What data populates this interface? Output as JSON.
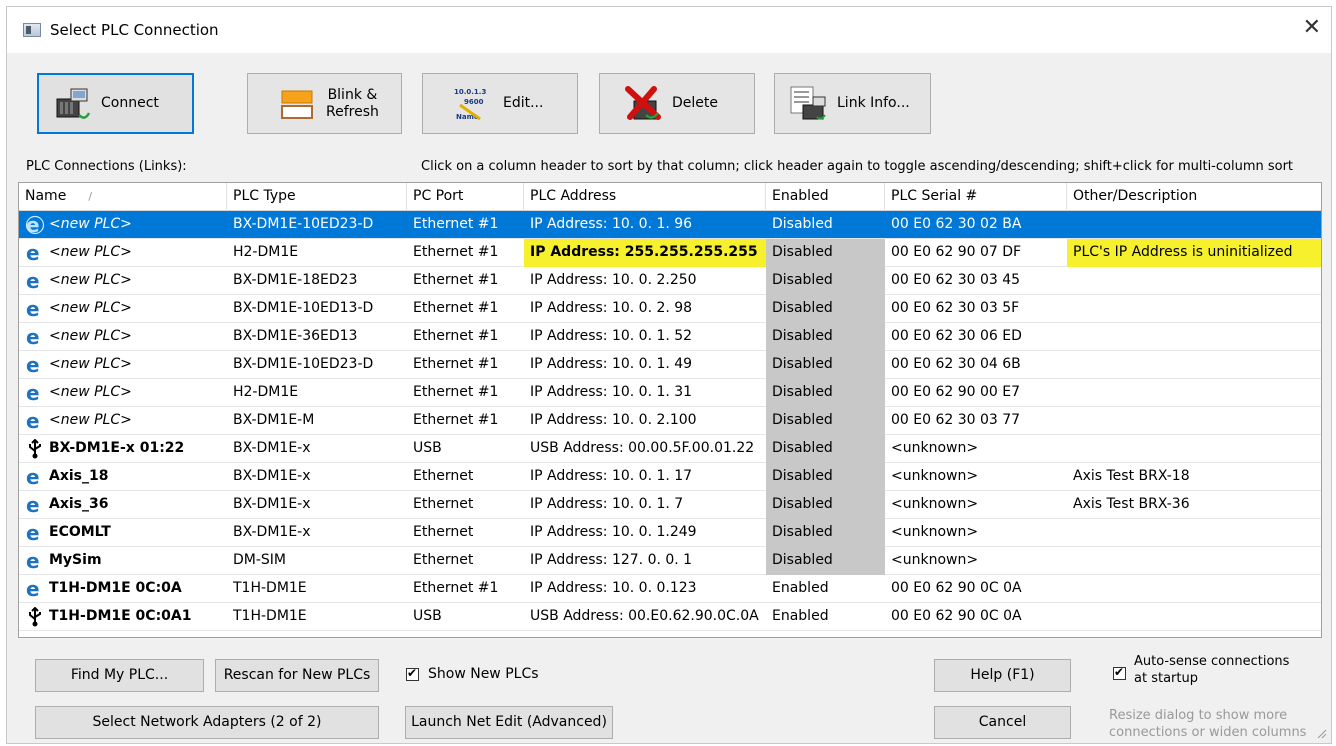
{
  "window": {
    "title": "Select PLC Connection"
  },
  "toolbar": {
    "connect": "Connect",
    "blink_refresh": [
      "Blink &",
      "Refresh"
    ],
    "edit": "Edit...",
    "delete": "Delete",
    "link_info": "Link Info...",
    "edit_icon_text": [
      "10.0.1.3",
      "9600",
      "Name"
    ]
  },
  "labels": {
    "connections": "PLC Connections (Links):",
    "hint": "Click on a column header to sort by that column; click header again to toggle ascending/descending; shift+click for multi-column sort"
  },
  "columns": [
    "Name",
    "PLC Type",
    "PC Port",
    "PLC Address",
    "Enabled",
    "PLC Serial #",
    "Other/Description"
  ],
  "sort_glyph": "/",
  "rows": [
    {
      "icon": "ethernet-selected",
      "name": "<new PLC>",
      "type": "BX-DM1E-10ED23-D",
      "port": "Ethernet #1",
      "address": "IP Address:  10.  0.  1. 96",
      "enabled": "Disabled",
      "serial": "00 E0 62 30 02 BA",
      "desc": "",
      "selected": true,
      "new": true
    },
    {
      "icon": "ethernet",
      "name": "<new PLC>",
      "type": "H2-DM1E",
      "port": "Ethernet #1",
      "address": "IP Address: 255.255.255.255",
      "enabled": "Disabled",
      "serial": "00 E0 62 90 07 DF",
      "desc": "PLC's IP Address is uninitialized",
      "warn": true,
      "new": true
    },
    {
      "icon": "ethernet",
      "name": "<new PLC>",
      "type": "BX-DM1E-18ED23",
      "port": "Ethernet #1",
      "address": "IP Address:  10.  0.  2.250",
      "enabled": "Disabled",
      "serial": "00 E0 62 30 03 45",
      "desc": "",
      "new": true
    },
    {
      "icon": "ethernet",
      "name": "<new PLC>",
      "type": "BX-DM1E-10ED13-D",
      "port": "Ethernet #1",
      "address": "IP Address:  10.  0.  2. 98",
      "enabled": "Disabled",
      "serial": "00 E0 62 30 03 5F",
      "desc": "",
      "new": true
    },
    {
      "icon": "ethernet",
      "name": "<new PLC>",
      "type": "BX-DM1E-36ED13",
      "port": "Ethernet #1",
      "address": "IP Address:  10.  0.  1. 52",
      "enabled": "Disabled",
      "serial": "00 E0 62 30 06 ED",
      "desc": "",
      "new": true
    },
    {
      "icon": "ethernet",
      "name": "<new PLC>",
      "type": "BX-DM1E-10ED23-D",
      "port": "Ethernet #1",
      "address": "IP Address:  10.  0.  1. 49",
      "enabled": "Disabled",
      "serial": "00 E0 62 30 04 6B",
      "desc": "",
      "new": true
    },
    {
      "icon": "ethernet",
      "name": "<new PLC>",
      "type": "H2-DM1E",
      "port": "Ethernet #1",
      "address": "IP Address:  10.  0.  1. 31",
      "enabled": "Disabled",
      "serial": "00 E0 62 90 00 E7",
      "desc": "",
      "new": true
    },
    {
      "icon": "ethernet",
      "name": "<new PLC>",
      "type": "BX-DM1E-M",
      "port": "Ethernet #1",
      "address": "IP Address:  10.  0.  2.100",
      "enabled": "Disabled",
      "serial": "00 E0 62 30 03 77",
      "desc": "",
      "new": true
    },
    {
      "icon": "usb",
      "name": "BX-DM1E-x 01:22",
      "type": "BX-DM1E-x",
      "port": "USB",
      "address": "USB Address: 00.00.5F.00.01.22",
      "enabled": "Disabled",
      "serial": "<unknown>",
      "desc": ""
    },
    {
      "icon": "ethernet",
      "name": "Axis_18",
      "type": "BX-DM1E-x",
      "port": "Ethernet",
      "address": "IP Address:  10.  0.  1. 17",
      "enabled": "Disabled",
      "serial": "<unknown>",
      "desc": "Axis Test BRX-18"
    },
    {
      "icon": "ethernet",
      "name": "Axis_36",
      "type": "BX-DM1E-x",
      "port": "Ethernet",
      "address": "IP Address:  10.  0.  1.  7",
      "enabled": "Disabled",
      "serial": "<unknown>",
      "desc": "Axis Test BRX-36"
    },
    {
      "icon": "ethernet",
      "name": "ECOMLT",
      "type": "BX-DM1E-x",
      "port": "Ethernet",
      "address": "IP Address:  10.  0.  1.249",
      "enabled": "Disabled",
      "serial": "<unknown>",
      "desc": ""
    },
    {
      "icon": "ethernet",
      "name": "MySim",
      "type": "DM-SIM",
      "port": "Ethernet",
      "address": "IP Address: 127.  0.  0.  1",
      "enabled": "Disabled",
      "serial": "<unknown>",
      "desc": ""
    },
    {
      "icon": "ethernet",
      "name": "T1H-DM1E 0C:0A",
      "type": "T1H-DM1E",
      "port": "Ethernet #1",
      "address": "IP Address:  10.  0.  0.123",
      "enabled": "Enabled",
      "serial": "00 E0 62 90 0C 0A",
      "desc": ""
    },
    {
      "icon": "usb",
      "name": "T1H-DM1E 0C:0A1",
      "type": "T1H-DM1E",
      "port": "USB",
      "address": "USB Address: 00.E0.62.90.0C.0A",
      "enabled": "Enabled",
      "serial": "00 E0 62 90 0C 0A",
      "desc": ""
    }
  ],
  "bottom": {
    "find_plc": "Find My PLC...",
    "rescan": "Rescan for New PLCs",
    "show_new": "Show New PLCs",
    "select_adapters": "Select Network Adapters (2 of 2)",
    "net_edit": "Launch Net Edit (Advanced)",
    "help": "Help (F1)",
    "cancel": "Cancel",
    "auto_sense": [
      "Auto-sense connections",
      "at startup"
    ],
    "resize_hint": [
      "Resize dialog to show more",
      "connections or widen columns"
    ]
  },
  "colors": {
    "accent": "#0078d7",
    "warn": "#f6f02d",
    "disabled_cell": "#c8c8c8",
    "ie_blue": "#1e73be"
  }
}
